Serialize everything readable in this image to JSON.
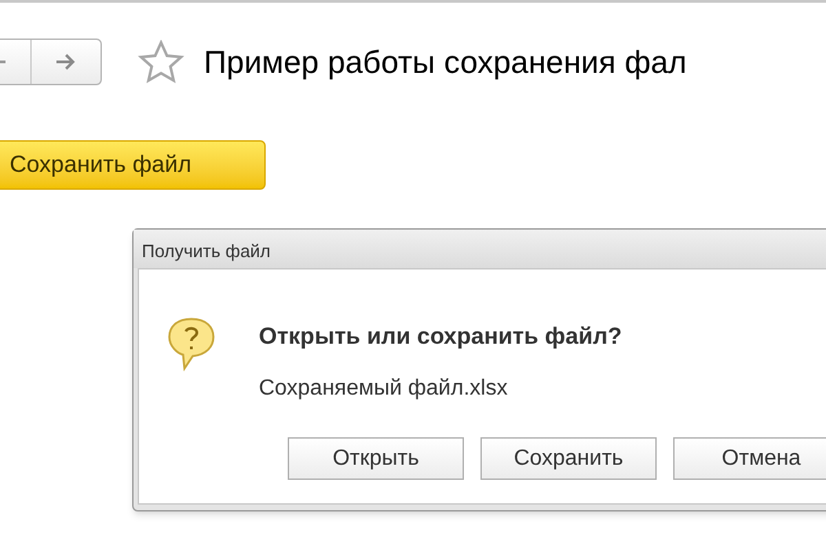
{
  "page": {
    "title": "Пример работы сохранения фал",
    "favorite": false
  },
  "save_button": {
    "label": "Сохранить файл"
  },
  "dialog": {
    "title": "Получить файл",
    "question": "Открыть или сохранить файл?",
    "file_name": "Сохраняемый файл.xlsx",
    "buttons": [
      {
        "label": "Открыть"
      },
      {
        "label": "Сохранить"
      },
      {
        "label": "Отмена"
      }
    ]
  }
}
